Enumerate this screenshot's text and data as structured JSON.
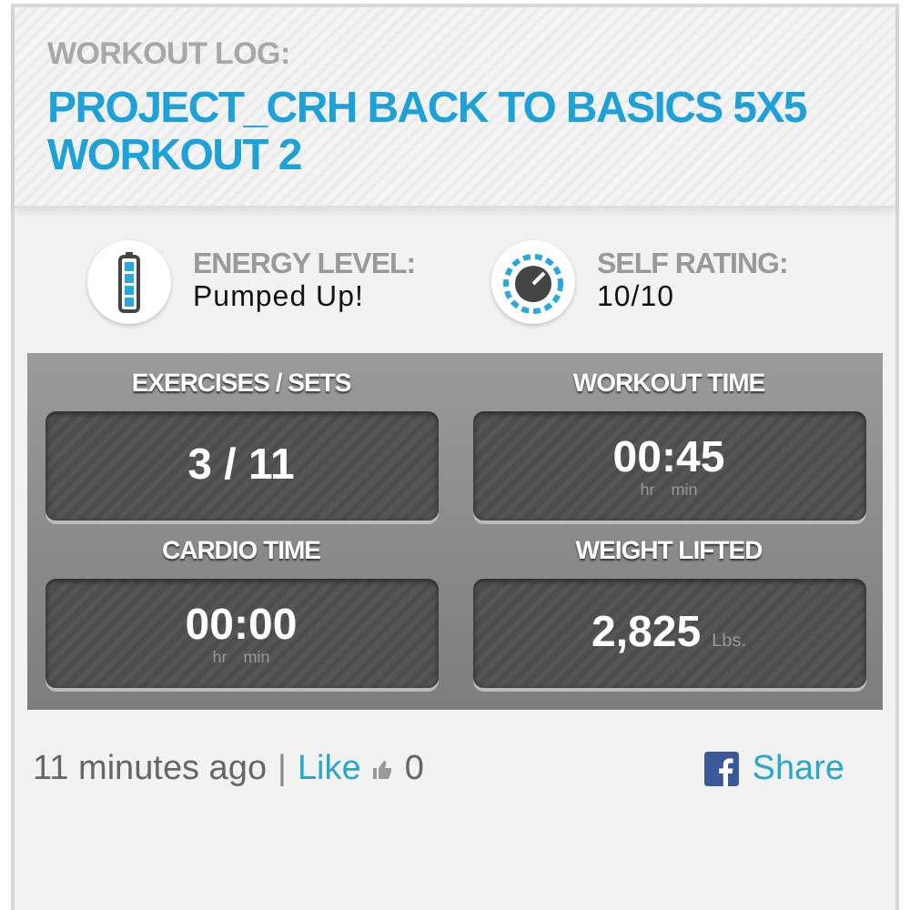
{
  "header": {
    "label": "WORKOUT LOG:",
    "title": "PROJECT_CRH BACK TO BASICS 5X5 WORKOUT 2"
  },
  "info": [
    {
      "kind": "battery",
      "label": "ENERGY LEVEL:",
      "value": "Pumped Up!"
    },
    {
      "kind": "dial",
      "label": "SELF RATING:",
      "value": "10/10"
    }
  ],
  "stats": [
    {
      "label": "EXERCISES / SETS",
      "value": "3 / 11"
    },
    {
      "label": "WORKOUT TIME",
      "value": "00:45",
      "sub": [
        "hr",
        "min"
      ]
    },
    {
      "label": "CARDIO TIME",
      "value": "00:00",
      "sub": [
        "hr",
        "min"
      ]
    },
    {
      "label": "WEIGHT LIFTED",
      "value": "2,825",
      "unit": "Lbs."
    }
  ],
  "footer": {
    "time": "11 minutes ago",
    "separator": "|",
    "like": "Like",
    "likes": "0",
    "share": "Share"
  }
}
